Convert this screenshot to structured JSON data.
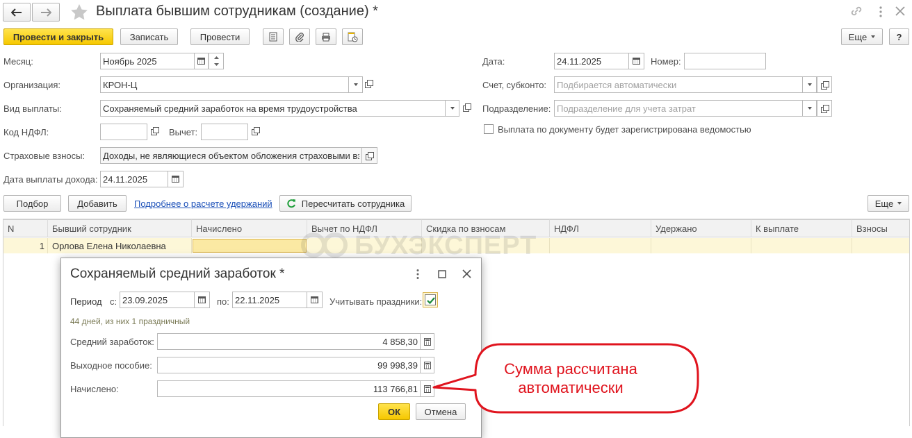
{
  "window": {
    "title": "Выплата бывшим сотрудникам (создание) *"
  },
  "toolbar": {
    "post_and_close": "Провести и закрыть",
    "save": "Записать",
    "post": "Провести",
    "more": "Еще",
    "help": "?"
  },
  "form": {
    "month_label": "Месяц:",
    "month_value": "Ноябрь 2025",
    "org_label": "Организация:",
    "org_value": "КРОН-Ц",
    "pay_type_label": "Вид выплаты:",
    "pay_type_value": "Сохраняемый средний заработок на время трудоустройства",
    "ndfl_code_label": "Код НДФЛ:",
    "ndfl_code_value": "",
    "deduction_label": "Вычет:",
    "deduction_value": "",
    "insurance_label": "Страховые взносы:",
    "insurance_value": "Доходы, не являющиеся объектом обложения страховыми вз",
    "income_date_label": "Дата выплаты дохода:",
    "income_date_value": "24.11.2025",
    "date_label": "Дата:",
    "date_value": "24.11.2025",
    "number_label": "Номер:",
    "number_value": "",
    "account_label": "Счет, субконто:",
    "account_placeholder": "Подбирается автоматически",
    "department_label": "Подразделение:",
    "department_placeholder": "Подразделение для учета затрат",
    "statement_checkbox_label": "Выплата по документу будет зарегистрирована ведомостью"
  },
  "table_toolbar": {
    "pick": "Подбор",
    "add": "Добавить",
    "details_link": "Подробнее о расчете удержаний",
    "recalc": "Пересчитать сотрудника",
    "more": "Еще"
  },
  "table": {
    "columns": [
      "N",
      "Бывший сотрудник",
      "Начислено",
      "Вычет по НДФЛ",
      "Скидка по взносам",
      "НДФЛ",
      "Удержано",
      "К выплате",
      "Взносы"
    ],
    "rows": [
      {
        "n": "1",
        "employee": "Орлова Елена Николаевна",
        "accrued": "",
        "ndfl_deduction": "",
        "discount": "",
        "ndfl": "",
        "withheld": "",
        "to_pay": "",
        "contributions": ""
      }
    ]
  },
  "watermark": "БУХЭКСПЕРТ",
  "dialog": {
    "title": "Сохраняемый средний заработок *",
    "period_label": "Период",
    "from_label": "с:",
    "from_value": "23.09.2025",
    "to_label": "по:",
    "to_value": "22.11.2025",
    "holidays_label": "Учитывать праздники:",
    "holidays_checked": true,
    "days_info": "44 дней, из них 1 праздничный",
    "avg_label": "Средний заработок:",
    "avg_value": "4 858,30",
    "severance_label": "Выходное пособие:",
    "severance_value": "99 998,39",
    "accrued_label": "Начислено:",
    "accrued_value": "113 766,81",
    "ok": "ОК",
    "cancel": "Отмена"
  },
  "callout": {
    "text": "Сумма рассчитана автоматически",
    "color": "#e0141e"
  }
}
